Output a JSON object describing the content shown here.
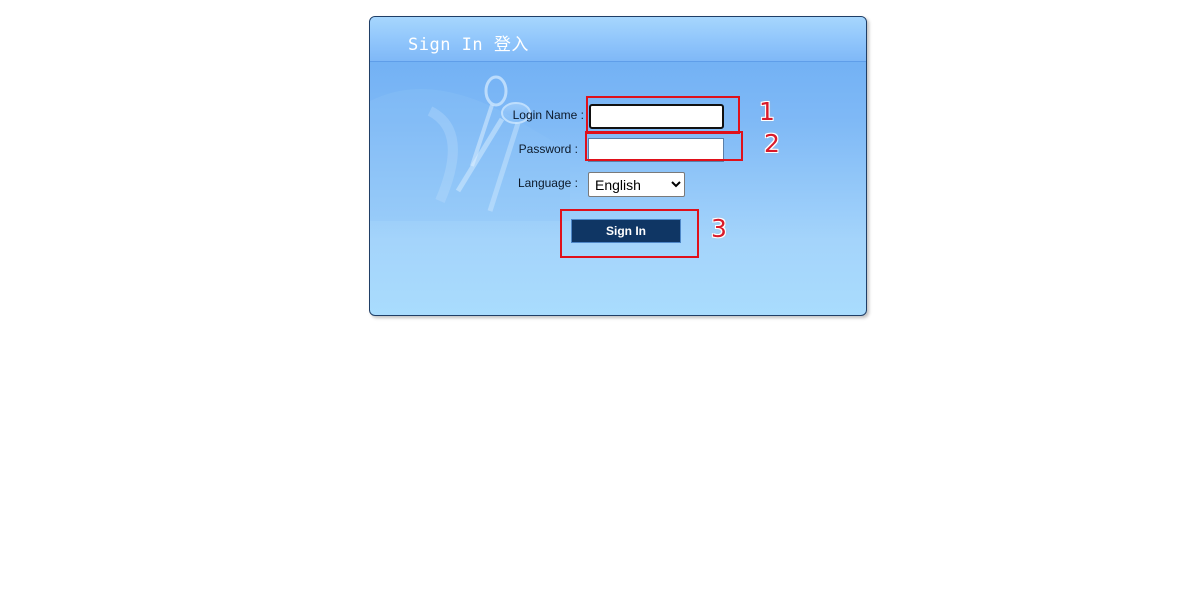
{
  "header": {
    "title": "Sign In 登入"
  },
  "form": {
    "login_label": "Login Name :",
    "login_value": "",
    "password_label": "Password :",
    "password_value": "",
    "language_label": "Language :",
    "language_selected": "English",
    "signin_label": "Sign In"
  },
  "annotations": {
    "step1": "1",
    "step2": "2",
    "step3": "3"
  },
  "colors": {
    "annotation_red": "#e0101a",
    "button_navy": "#0f3664",
    "panel_blue": "#7fb9f6"
  },
  "icons": {
    "background_art": "keys-icon"
  }
}
